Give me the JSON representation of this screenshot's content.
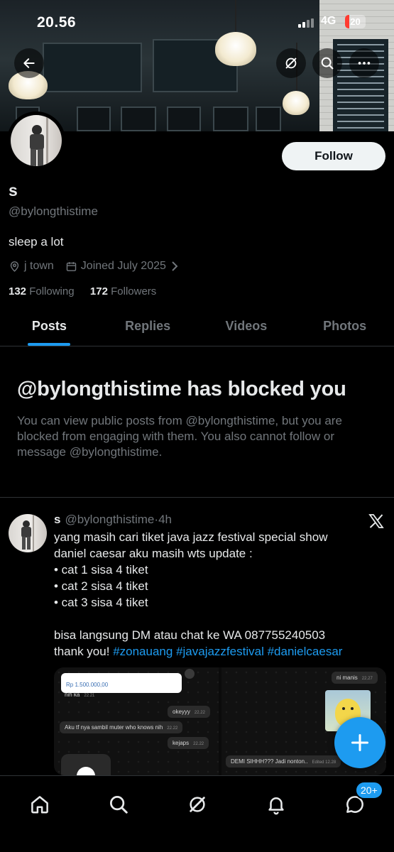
{
  "status_bar": {
    "time": "20.56",
    "network": "4G",
    "battery": "20",
    "battery_level": 0.2
  },
  "header": {
    "back_icon": "arrow-left-icon",
    "grok_icon": "grok-icon",
    "search_icon": "search-icon",
    "more_icon": "more-dots-icon"
  },
  "profile": {
    "name": "s",
    "handle": "@bylongthistime",
    "bio": "sleep a lot",
    "location": "j town",
    "joined": "Joined July 2025",
    "following_count": "132",
    "following_label": "Following",
    "followers_count": "172",
    "followers_label": "Followers",
    "follow_label": "Follow"
  },
  "tabs": [
    {
      "label": "Posts",
      "active": true
    },
    {
      "label": "Replies",
      "active": false
    },
    {
      "label": "Videos",
      "active": false
    },
    {
      "label": "Photos",
      "active": false
    }
  ],
  "blocked": {
    "title": "@bylongthistime has blocked you",
    "text": "You can view public posts from @bylongthistime, but you are blocked from engaging with them. You also cannot follow or message @bylongthistime."
  },
  "post": {
    "name": "s",
    "handle": "@bylongthistime",
    "dot": "·",
    "time": "4h",
    "lines": [
      "yang masih cari tiket java jazz festival special show",
      "daniel caesar aku masih wts update :",
      "• cat 1 sisa 4 tiket",
      "• cat 2 sisa 4 tiket",
      "• cat 3 sisa 4 tiket"
    ],
    "line_contact": "bisa langsung DM atau chat ke WA 087755240503",
    "line_thanks": "thank you!",
    "hashtags": [
      "#zonauang",
      "#javajazzfestival",
      "#danielcaesar"
    ],
    "media_left": {
      "amount": "Rp 1.500.000,00",
      "msg1": "nih ka",
      "msg1_time": "22.21",
      "msg2": "okeyyy",
      "msg2_time": "22.22",
      "msg3": "Aku tf nya sambil muter who knows nih",
      "msg3_time": "22.22",
      "msg4": "kejaps",
      "msg4_time": "22.22"
    },
    "media_right": {
      "msg1": "ni manis",
      "msg1_time": "22.27",
      "msg2": "DEMI SIHHH??? Jadi nonton..",
      "msg2_time": "Edited 12.28"
    }
  },
  "bottom_nav": {
    "items": [
      "home-icon",
      "search-icon",
      "grok-icon",
      "notifications-icon",
      "messages-icon"
    ],
    "messages_badge": "20+"
  },
  "colors": {
    "accent": "#1d9bf0",
    "muted": "#71767b",
    "text": "#e7e9ea",
    "border": "#2f3336"
  }
}
